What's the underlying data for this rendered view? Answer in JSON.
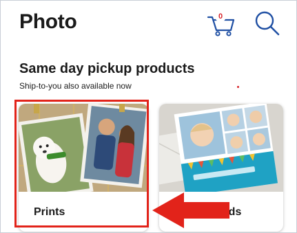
{
  "header": {
    "title": "Photo",
    "cart_count": "0",
    "cart_icon": "cart-icon",
    "search_icon": "search-icon"
  },
  "section": {
    "title": "Same day pickup products",
    "subtitle": "Ship-to-you also available now"
  },
  "products": [
    {
      "label": "Prints",
      "image": "prints-collage-photo"
    },
    {
      "label": "Cards",
      "image": "cards-baby-photo"
    }
  ],
  "annotation": {
    "highlight_color": "#e2231a",
    "arrow_icon": "red-arrow-icon"
  },
  "colors": {
    "accent": "#d8232a",
    "text": "#1a1a1a"
  }
}
